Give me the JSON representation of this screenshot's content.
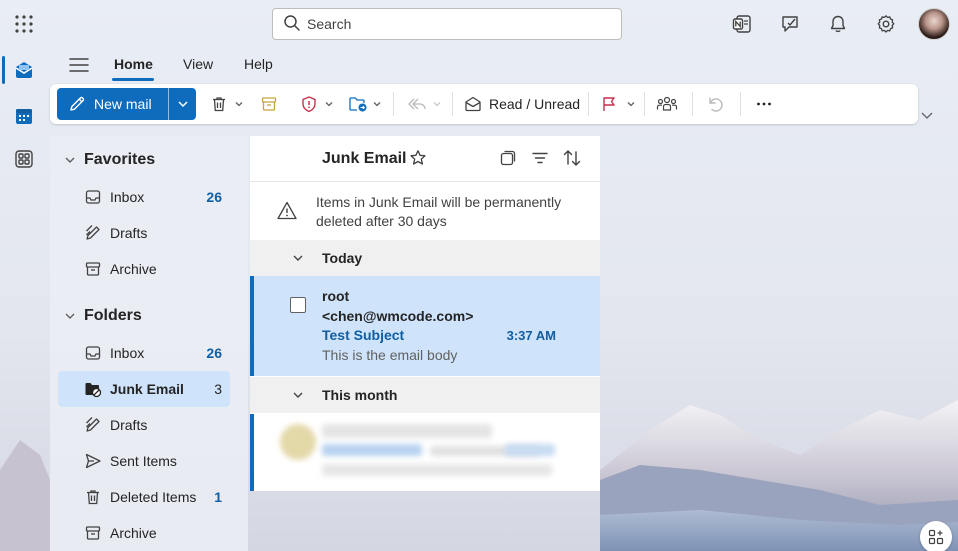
{
  "search": {
    "placeholder": "Search"
  },
  "ribbon": {
    "tabs": [
      {
        "label": "Home",
        "active": true
      },
      {
        "label": "View",
        "active": false
      },
      {
        "label": "Help",
        "active": false
      }
    ],
    "new_mail_label": "New mail",
    "read_unread_label": "Read / Unread"
  },
  "folders": {
    "favorites_label": "Favorites",
    "favorites": [
      {
        "name": "Inbox",
        "count": "26",
        "icon": "inbox-icon"
      },
      {
        "name": "Drafts",
        "count": "",
        "icon": "drafts-icon"
      },
      {
        "name": "Archive",
        "count": "",
        "icon": "archive-icon"
      }
    ],
    "folders_label": "Folders",
    "items": [
      {
        "name": "Inbox",
        "count": "26",
        "icon": "inbox-icon",
        "selected": false
      },
      {
        "name": "Junk Email",
        "count": "3",
        "icon": "junk-folder-icon",
        "selected": true
      },
      {
        "name": "Drafts",
        "count": "",
        "icon": "drafts-icon",
        "selected": false
      },
      {
        "name": "Sent Items",
        "count": "",
        "icon": "send-icon",
        "selected": false
      },
      {
        "name": "Deleted Items",
        "count": "1",
        "icon": "trash-icon",
        "selected": false
      },
      {
        "name": "Archive",
        "count": "",
        "icon": "archive-icon",
        "selected": false
      }
    ]
  },
  "message_list": {
    "title": "Junk Email",
    "notice": "Items in Junk Email will be permanently deleted after 30 days",
    "groups": [
      {
        "label": "Today",
        "messages": [
          {
            "sender_line1": "root",
            "sender_line2": "<chen@wmcode.com>",
            "subject": "Test Subject",
            "time": "3:37 AM",
            "preview": "This is the email body"
          }
        ]
      },
      {
        "label": "This month"
      }
    ]
  },
  "colors": {
    "accent": "#0f6cbd",
    "selected_bg": "#cfe4fa",
    "unread_text": "#115ea3"
  }
}
